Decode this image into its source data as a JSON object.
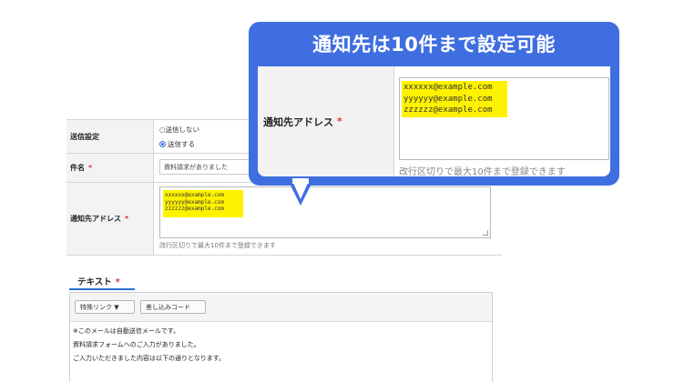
{
  "form": {
    "send_setting": {
      "label": "送信設定",
      "options": [
        "○送信しない",
        "送信する"
      ],
      "selected": "送信する"
    },
    "subject": {
      "label": "件名",
      "required_mark": "*",
      "value": "資料請求がありました"
    },
    "address": {
      "label": "通知先アドレス",
      "required_mark": "*",
      "lines": [
        "xxxxxx@example.com",
        "yyyyyy@example.com",
        "zzzzzz@example.com"
      ],
      "help": "改行区切りで最大10件まで登録できます"
    },
    "text_tab": {
      "label": "テキスト",
      "required_mark": "*"
    },
    "toolbar": {
      "special_link": "特殊リンク ▼",
      "insert_code": "差し込みコード"
    },
    "body_lines": [
      "※このメールは自動送信メールです。",
      "資料請求フォームへのご入力がありました。",
      "ご入力いただきました内容は以下の通りとなります。"
    ]
  },
  "callout": {
    "title": "通知先は10件まで設定可能",
    "label": "通知先アドレス",
    "required_mark": "*",
    "lines": [
      "xxxxxx@example.com",
      "yyyyyy@example.com",
      "zzzzzz@example.com"
    ],
    "help": "改行区切りで最大10件まで登録できます"
  },
  "colors": {
    "accent": "#3f6ee0",
    "highlight": "#fff200",
    "required": "#dd3333"
  }
}
